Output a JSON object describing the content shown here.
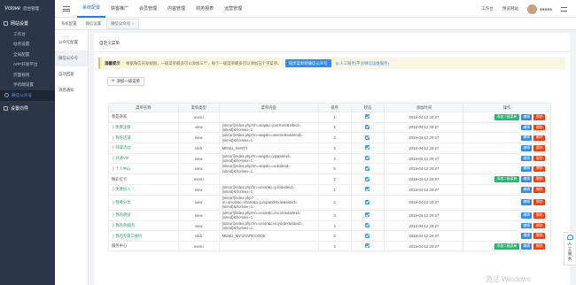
{
  "app": {
    "logo": "Vclove",
    "logo_sub": "后台管理"
  },
  "sidebar": {
    "group1": "网站设置",
    "items": [
      {
        "label": "工作台",
        "active": false
      },
      {
        "label": "站点设置",
        "active": false
      },
      {
        "label": "全局配置",
        "active": false
      },
      {
        "label": "APP开发平台",
        "active": false
      },
      {
        "label": "页面规则",
        "active": false
      },
      {
        "label": "手机端设置",
        "active": false
      },
      {
        "label": "微信公众号",
        "active": true
      }
    ],
    "group2": "设置向导"
  },
  "topnav": {
    "items": [
      {
        "label": "系统配置",
        "active": true
      },
      {
        "label": "获客推广",
        "active": false
      },
      {
        "label": "会员管理",
        "active": false
      },
      {
        "label": "内容管理",
        "active": false
      },
      {
        "label": "财务报表",
        "active": false
      },
      {
        "label": "运营管理",
        "active": false
      }
    ],
    "right": [
      "工作台",
      "预览网站"
    ],
    "username": "■■■■■"
  },
  "page_tabs": [
    "系统配置",
    "微信设置",
    "微信公众号"
  ],
  "subside": [
    {
      "label": "公众号配置",
      "active": false
    },
    {
      "label": "微信公众号",
      "active": true
    },
    {
      "label": "自动回复",
      "active": false
    },
    {
      "label": "消息通知",
      "active": false
    }
  ],
  "main": {
    "title": "自定义菜单",
    "notice_label": "温馨提示",
    "notice_text": "：根据微信开发规则，一级菜单最多可以添加三个，每个一级菜单最多可以添加五个子菜单。",
    "notice_button": "同步菜单到微信公众号",
    "notice_service": "人工服务(平台微信运维服务)",
    "add_button": "添加一级菜单"
  },
  "table": {
    "headers": [
      "菜单名称",
      "菜单类型",
      "菜单内容",
      "排序",
      "状态",
      "添加时间",
      "操作"
    ],
    "ops": {
      "add_sub": "添加二级菜单",
      "edit": "编辑",
      "delete": "删除"
    },
    "rows": [
      {
        "name": "我是商家",
        "child": false,
        "type": "menu",
        "content": "",
        "sort": "1",
        "time": "2019-04-12 20:27",
        "tall": false
      },
      {
        "name": "├ 免费注册",
        "child": true,
        "type": "view",
        "content": "{siteurl}index.php?m=wap&c=joinstore&siteid={siteid}&fromwx=1",
        "sort": "1",
        "time": "2019-04-12 20:27",
        "tall": false
      },
      {
        "name": "├ 我的店铺",
        "child": true,
        "type": "view",
        "content": "{siteurl}index.php?m=wap&c=userindex&siteid={siteid}&fromwx=1",
        "sort": "2",
        "time": "2019-04-12 20:27",
        "tall": false
      },
      {
        "name": "├ 领取活动",
        "child": true,
        "type": "click",
        "content": "MENU_PARTY",
        "sort": "3",
        "time": "2019-04-12 20:27",
        "tall": false
      },
      {
        "name": "├ 开通VIP",
        "child": true,
        "type": "view",
        "content": "{siteurl}index.php?m=wap&c=vip&siteid={siteid}&fromwx=1",
        "sort": "4",
        "time": "2019-04-12 20:27",
        "tall": false
      },
      {
        "name": "├ 个人中心",
        "child": true,
        "type": "view",
        "content": "{siteurl}index.php?m=wap&c=uc&siteid={siteid}&fromwx=1",
        "sort": "5",
        "time": "2019-04-12 20:27",
        "tall": false
      },
      {
        "name": "精彩打卡",
        "child": false,
        "type": "menu",
        "content": "",
        "sort": "2",
        "time": "2019-04-12 20:27",
        "tall": false
      },
      {
        "name": "├ 免费加入",
        "child": true,
        "type": "view",
        "content": "{siteurl}index.php?m=union&c=join&siteid={siteid}&fromwx=1",
        "sort": "1",
        "time": "2019-04-12 20:27",
        "tall": false
      },
      {
        "name": "├ 我要分享",
        "child": true,
        "type": "view",
        "content": "{siteurl}index.php?m=union&c=share&a=jumpandshow&siteid={siteid}&fromwx=1",
        "sort": "2",
        "time": "2019-04-12 20:27",
        "tall": true
      },
      {
        "name": "├ 我的收益",
        "child": true,
        "type": "view",
        "content": "{siteurl}index.php?m=union&c=income&siteid={siteid}&fromwx=1",
        "sort": "3",
        "time": "2019-04-12 20:27",
        "tall": false
      },
      {
        "name": "├ 我的单据团",
        "child": true,
        "type": "view",
        "content": "{siteurl}index.php?m=union&c=myorder&siteid={siteid}&fromwx=1",
        "sort": "4",
        "time": "2019-04-12 20:27",
        "tall": false
      },
      {
        "name": "├ 我的专属二维码",
        "child": true,
        "type": "click",
        "content": "MENU_MYSHARECODE",
        "sort": "5",
        "time": "2019-04-12 20:27",
        "tall": false
      },
      {
        "name": "服务中心",
        "child": false,
        "type": "menu",
        "content": "",
        "sort": "3",
        "time": "2019-04-12 20:27",
        "tall": false
      }
    ]
  },
  "float_service": {
    "line1": "人",
    "line2": "工",
    "line3": "服",
    "line4": "务"
  },
  "watermark": "激活 Windows"
}
